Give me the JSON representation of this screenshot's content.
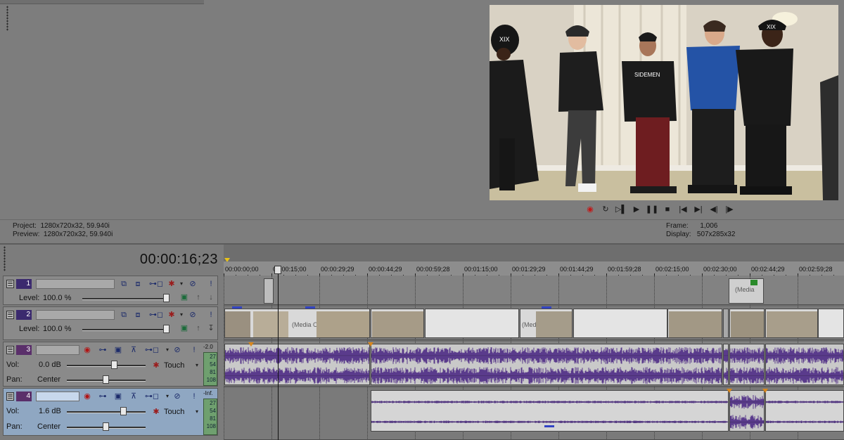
{
  "preview": {
    "project_label": "Project:",
    "project_value": "1280x720x32, 59.940i",
    "preview_label": "Preview:",
    "preview_value": "1280x720x32, 59.940i",
    "frame_label": "Frame:",
    "frame_value": "1,006",
    "display_label": "Display:",
    "display_value": "507x285x32",
    "video_frame": {
      "cap_text": "XIX",
      "cap_text_2": "XIX",
      "shirt_text": "SIDEMEN"
    }
  },
  "transport": {
    "buttons": [
      {
        "name": "record-button",
        "icon": "record-icon",
        "glyph": "◉"
      },
      {
        "name": "loop-button",
        "icon": "loop-icon",
        "glyph": "↻"
      },
      {
        "name": "play-from-start-button",
        "icon": "play-from-start-icon",
        "glyph": "▷▌"
      },
      {
        "name": "play-button",
        "icon": "play-icon",
        "glyph": "▶"
      },
      {
        "name": "pause-button",
        "icon": "pause-icon",
        "glyph": "❚❚"
      },
      {
        "name": "stop-button",
        "icon": "stop-icon",
        "glyph": "■"
      },
      {
        "name": "go-to-start-button",
        "icon": "go-to-start-icon",
        "glyph": "|◀"
      },
      {
        "name": "go-to-end-button",
        "icon": "go-to-end-icon",
        "glyph": "▶|"
      },
      {
        "name": "previous-frame-button",
        "icon": "previous-frame-icon",
        "glyph": "◀|"
      },
      {
        "name": "next-frame-button",
        "icon": "next-frame-icon",
        "glyph": "|▶"
      }
    ]
  },
  "timeline": {
    "timecode": "00:00:16;23",
    "ruler": [
      {
        "label": "00:00:00;00"
      },
      {
        "label": "00:00:15;00"
      },
      {
        "label": "00:00:29;29"
      },
      {
        "label": "00:00:44;29"
      },
      {
        "label": "00:00:59;28"
      },
      {
        "label": "00:01:15;00"
      },
      {
        "label": "00:01:29;29"
      },
      {
        "label": "00:01:44;29"
      },
      {
        "label": "00:01:59;28"
      },
      {
        "label": "00:02:15;00"
      },
      {
        "label": "00:02:30;00"
      },
      {
        "label": "00:02:44;29"
      },
      {
        "label": "00:02:59;28"
      }
    ],
    "clip_media_label": "(Media Of",
    "clip_media_label_2": "(Media",
    "clip_media_label_3": "(Media Of"
  },
  "tracks": {
    "video1": {
      "number": "1",
      "level_label": "Level:",
      "level_value": "100.0 %",
      "level": 1.0
    },
    "video2": {
      "number": "2",
      "level_label": "Level:",
      "level_value": "100.0 %",
      "level": 1.0
    },
    "audio3": {
      "number": "3",
      "vol_label": "Vol:",
      "vol_value": "0.0 dB",
      "pan_label": "Pan:",
      "pan_value": "Center",
      "automation": "Touch",
      "meter_peak": "-2.0",
      "meter_scale": [
        "27",
        "54",
        "81",
        "108"
      ]
    },
    "audio4": {
      "number": "4",
      "vol_label": "Vol:",
      "vol_value": "1.6 dB",
      "pan_label": "Pan:",
      "pan_value": "Center",
      "automation": "Touch",
      "meter_peak": "-Inf.",
      "meter_scale": [
        "27",
        "54",
        "81",
        "108"
      ]
    }
  },
  "colors": {
    "waveform": "#5a3b8c",
    "selected_track": "#8fa7c2",
    "cursor": "#111111"
  }
}
